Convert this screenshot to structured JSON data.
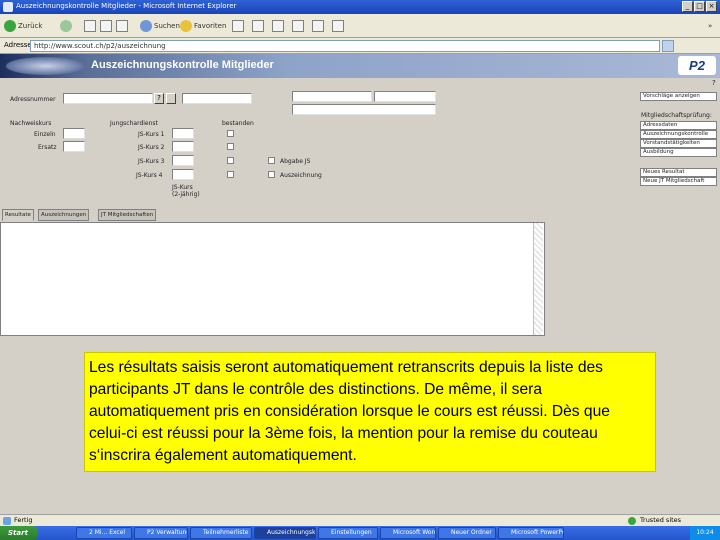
{
  "window": {
    "title": "Auszeichnungskontrolle Mitglieder - Microsoft Internet Explorer",
    "controls": {
      "minimize": "_",
      "maximize": "□",
      "close": "×"
    }
  },
  "toolbar": {
    "back_label": "Zurück",
    "search_label": "Suchen",
    "favorites_label": "Favoriten",
    "go_label": "»"
  },
  "addressbar": {
    "label": "Adresse",
    "url": "http://www.scout.ch/p2/auszeichnung"
  },
  "app": {
    "title": "Auszeichnungskontrolle Mitglieder",
    "brand": "P2",
    "help": "?"
  },
  "form": {
    "adressnummer_label": "Adressnummer",
    "lookup_btn": "?",
    "nachweiskurs_label": "Nachweiskurs",
    "nachweis": [
      "Einzeln",
      "Ersatz"
    ],
    "jungschar_label": "Jungschardienst",
    "bestanden_label": "bestanden",
    "kurse": [
      "JS-Kurs 1",
      "JS-Kurs 2",
      "JS-Kurs 3",
      "JS-Kurs 4"
    ],
    "check_labels": [
      "Abgabe JS",
      "Auszeichnung"
    ],
    "note_small": [
      "JS-Kurs",
      "(2-jährig)"
    ]
  },
  "right_panel": {
    "top_button": "Vorschläge anzeigen",
    "section_label": "Mitgliedschaftsprüfung:",
    "buttons": [
      "Adressdaten",
      "Auszeichnungskontrolle",
      "Vorstandstätigkeiten",
      "Ausbildung"
    ],
    "bottom_buttons": [
      "Neues Resultat",
      "Neue JT Mitgliedschaft"
    ]
  },
  "tabs": [
    "Resultate",
    "Auszeichnungen",
    "JT Mitgliedschaften"
  ],
  "note": {
    "text": "Les résultats saisis seront automatiquement retranscrits depuis la liste des participants JT dans le contrôle des distinctions. De même, il sera automatiquement pris en considération lorsque le cours est réussi. Dès que celui-ci est réussi pour la 3ème fois, la mention pour la remise du couteau s‘inscrira également automatiquement."
  },
  "statusbar": {
    "status": "Fertig",
    "zone": "Trusted sites"
  },
  "taskbar": {
    "start": "Start",
    "tasks": [
      "2 Mi... Excel",
      "P2 Verwaltung",
      "Teilnehmerliste",
      "Auszeichnungsko...",
      "Einstellungen",
      "Microsoft Word",
      "Neuer Ordner",
      "Microsoft PowerPoint"
    ],
    "clock": "10:24"
  },
  "colors": {
    "note_background": "#ffff00",
    "header_gradient": "#1c2e5c",
    "brand": "#1d3a8a"
  },
  "icons": [
    "ie-icon",
    "back-icon",
    "search-icon",
    "favorites-icon",
    "lookup-icon",
    "status-icon",
    "zone-icon"
  ]
}
